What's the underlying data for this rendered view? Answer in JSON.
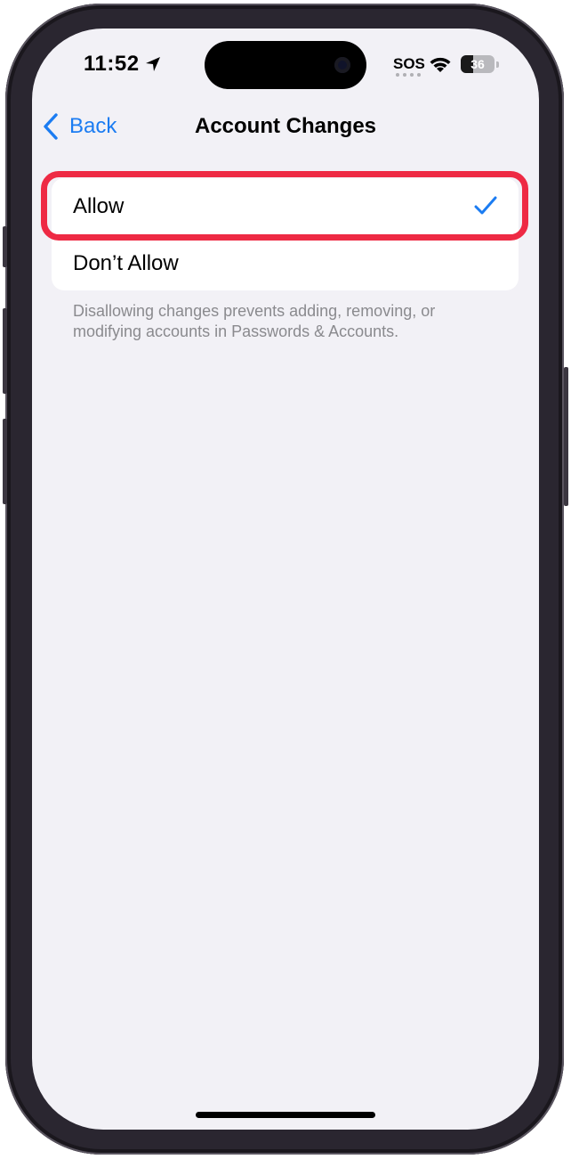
{
  "status_bar": {
    "time": "11:52",
    "carrier_status": "SOS",
    "battery_level": "36",
    "battery_fraction": 0.36,
    "icons": [
      "location-arrow-icon",
      "wifi-icon",
      "battery-icon"
    ]
  },
  "nav": {
    "back_label": "Back",
    "title": "Account Changes"
  },
  "options": [
    {
      "label": "Allow",
      "selected": true
    },
    {
      "label": "Don’t Allow",
      "selected": false
    }
  ],
  "footer_note": "Disallowing changes prevents adding, removing, or modifying accounts in Passwords & Accounts.",
  "colors": {
    "accent": "#1b7cf2",
    "highlight": "#ee2a44",
    "background": "#f2f1f6"
  }
}
